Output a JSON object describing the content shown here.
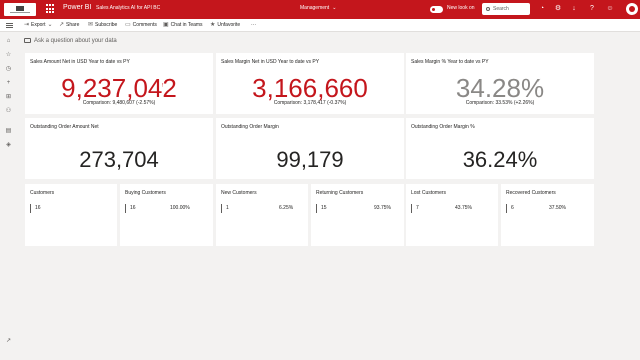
{
  "topbar": {
    "app_name": "Power BI",
    "report_title": "Sales Analytics AI for API BC",
    "workspace": "Management",
    "new_look_label": "New look on",
    "search_placeholder": "Search",
    "bg_color": "#c4161c"
  },
  "actionbar": {
    "export_label": "Export",
    "share_label": "Share",
    "subscribe_label": "Subscribe",
    "comments_label": "Comments",
    "chat_label": "Chat in Teams",
    "favorite_label": "Unfavorite",
    "more_label": "···"
  },
  "qa": {
    "placeholder": "Ask a question about your data"
  },
  "kpis": [
    {
      "title": "Sales Amount Net in USD Year to date vs PY",
      "value": "9,237,042",
      "indicator": "!",
      "comparison": "Comparison: 9,480,607 (-2.57%)",
      "status_color": "#c4161c"
    },
    {
      "title": "Sales Margin Net in USD Year to date vs PY",
      "value": "3,166,660",
      "indicator": "!",
      "comparison": "Comparison: 3,178,417 (-0.37%)",
      "status_color": "#c4161c"
    },
    {
      "title": "Sales Margin % Year to date vs PY",
      "value": "34.28%",
      "indicator": "✓",
      "comparison": "Comparison: 33.53% (+2.26%)",
      "status_color": "#8a8886"
    }
  ],
  "cards": [
    {
      "title": "Outstanding Order Amount Net",
      "value": "273,704"
    },
    {
      "title": "Outstanding Order Margin",
      "value": "99,179"
    },
    {
      "title": "Outstanding Order Margin %",
      "value": "36.24%"
    }
  ],
  "customers": [
    {
      "title": "Customers",
      "value": "16",
      "pct": ""
    },
    {
      "title": "Buying Customers",
      "value": "16",
      "pct": "100.00%"
    },
    {
      "title": "New Customers",
      "value": "1",
      "pct": "6.25%"
    },
    {
      "title": "Returning Customers",
      "value": "15",
      "pct": "93.75%"
    },
    {
      "title": "Lost Customers",
      "value": "7",
      "pct": "43.75%"
    },
    {
      "title": "Recovered Customers",
      "value": "6",
      "pct": "37.50%"
    }
  ]
}
